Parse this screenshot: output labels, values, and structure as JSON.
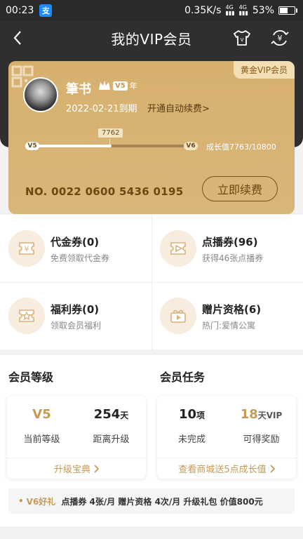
{
  "status_bar": {
    "time": "00:23",
    "app_badge": "支",
    "net_speed": "0.35K/s",
    "signal_1": "4G",
    "signal_2": "4G",
    "battery": "53%"
  },
  "nav": {
    "title": "我的VIP会员"
  },
  "vip_card": {
    "tag": "黄金VIP会员",
    "username": "筆书",
    "level_badge": "V5",
    "level_suffix": "年",
    "expire_text": "2022-02-21到期",
    "auto_renew_link": "开通自动续费>",
    "progress_marker": "7762",
    "progress_start_level": "V5",
    "progress_end_level": "V6",
    "progress_fraction": 0.5,
    "growth_text": "成长值7763/10800",
    "card_number": "NO. 0022 0600 5436 0195",
    "renew_button": "立即续费"
  },
  "coupons": [
    {
      "title": "代金券(0)",
      "subtitle": "免费领取代金券",
      "icon": "yen-coupon-icon"
    },
    {
      "title": "点播券(96)",
      "subtitle": "获得46张点播券",
      "icon": "play-coupon-icon"
    },
    {
      "title": "福利券(0)",
      "subtitle": "领取会员福利",
      "icon": "star-coupon-icon"
    },
    {
      "title": "赠片资格(6)",
      "subtitle": "热门:爱情公寓",
      "icon": "gift-video-icon"
    }
  ],
  "member_level": {
    "title": "会员等级",
    "current_value": "V5",
    "current_label": "当前等级",
    "distance_value": "254",
    "distance_unit": "天",
    "distance_label": "距离升级",
    "footer": "升级宝典"
  },
  "member_task": {
    "title": "会员任务",
    "incomplete_value": "10",
    "incomplete_unit": "项",
    "incomplete_label": "未完成",
    "reward_value": "18",
    "reward_unit": "天VIP",
    "reward_label": "可得奖励",
    "footer": "查看商城送5点成长值"
  },
  "v6_bar": {
    "dot": "•",
    "label": "V6好礼",
    "text": "点播券 4张/月  赠片资格 4次/月  升级礼包 价值800元"
  },
  "colors": {
    "card_gold": "#d7b06e",
    "accent_gold": "#c49a55",
    "header_dark": "#2f2f2f"
  }
}
